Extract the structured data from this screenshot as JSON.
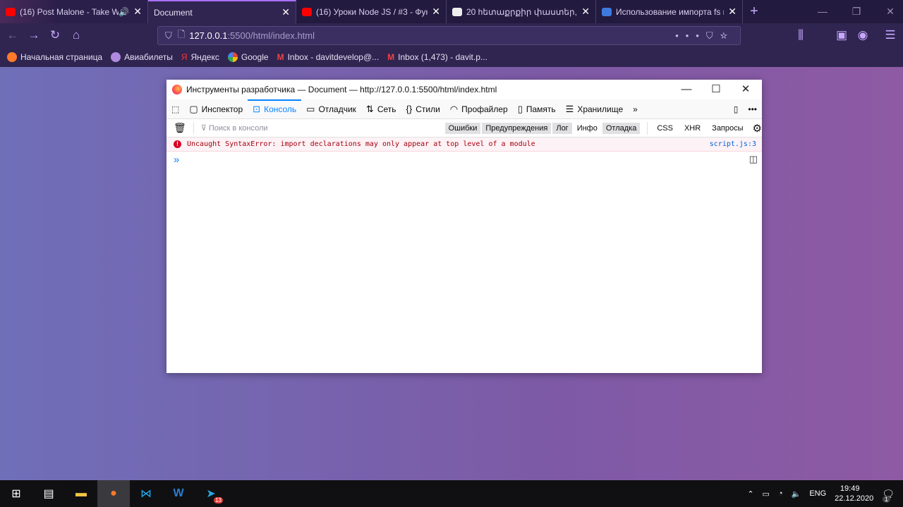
{
  "browser": {
    "tabs": [
      {
        "title": "(16) Post Malone - Take Wh",
        "favicon": "youtube-icon",
        "audio": true
      },
      {
        "title": "Document",
        "active": true
      },
      {
        "title": "(16) Уроки Node JS / #3 - Функ",
        "favicon": "youtube-icon"
      },
      {
        "title": "20 hետաքրքիր փաստեր, որո",
        "favicon": "i-icon"
      },
      {
        "title": "Использование импорта fs и",
        "favicon": "o-icon"
      }
    ],
    "new_tab": "+",
    "url": {
      "host": "127.0.0.1",
      "path": ":5500/html/index.html"
    },
    "bookmarks": [
      "Начальная страница",
      "Авиабилеты",
      "Яндекс",
      "Google",
      "Inbox - davitdevelop@...",
      "Inbox (1,473) - davit.p..."
    ],
    "colors": {
      "accent": "#a970ff"
    }
  },
  "devtools": {
    "title": "Инструменты разработчика — Document — http://127.0.0.1:5500/html/index.html",
    "tools": [
      "Инспектор",
      "Консоль",
      "Отладчик",
      "Сеть",
      "Стили",
      "Профайлер",
      "Память",
      "Хранилище"
    ],
    "filter_placeholder": "Поиск в консоли",
    "levels": [
      "Ошибки",
      "Предупреждения",
      "Лог",
      "Инфо",
      "Отладка"
    ],
    "types": [
      "CSS",
      "XHR",
      "Запросы"
    ],
    "error": {
      "message": "Uncaught SyntaxError: import declarations may only appear at top level of a module",
      "source": "script.js:3"
    },
    "prompt": "»"
  },
  "taskbar": {
    "lang": "ENG",
    "time": "19:49",
    "date": "22.12.2020",
    "notifications": "1",
    "telegram_badge": "13"
  }
}
